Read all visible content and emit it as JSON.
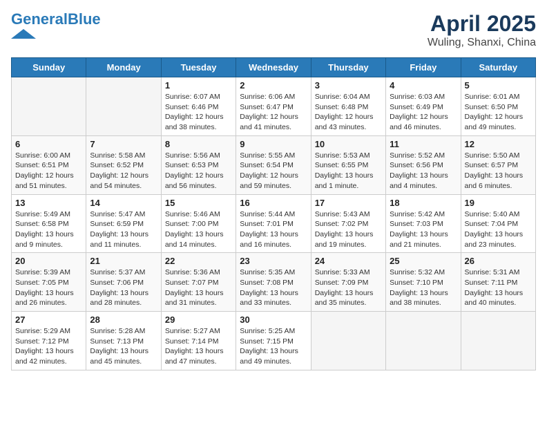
{
  "header": {
    "logo_line1": "General",
    "logo_line2": "Blue",
    "title": "April 2025",
    "subtitle": "Wuling, Shanxi, China"
  },
  "days_of_week": [
    "Sunday",
    "Monday",
    "Tuesday",
    "Wednesday",
    "Thursday",
    "Friday",
    "Saturday"
  ],
  "weeks": [
    [
      {
        "day": "",
        "empty": true
      },
      {
        "day": "",
        "empty": true
      },
      {
        "day": "1",
        "sunrise": "Sunrise: 6:07 AM",
        "sunset": "Sunset: 6:46 PM",
        "daylight": "Daylight: 12 hours and 38 minutes."
      },
      {
        "day": "2",
        "sunrise": "Sunrise: 6:06 AM",
        "sunset": "Sunset: 6:47 PM",
        "daylight": "Daylight: 12 hours and 41 minutes."
      },
      {
        "day": "3",
        "sunrise": "Sunrise: 6:04 AM",
        "sunset": "Sunset: 6:48 PM",
        "daylight": "Daylight: 12 hours and 43 minutes."
      },
      {
        "day": "4",
        "sunrise": "Sunrise: 6:03 AM",
        "sunset": "Sunset: 6:49 PM",
        "daylight": "Daylight: 12 hours and 46 minutes."
      },
      {
        "day": "5",
        "sunrise": "Sunrise: 6:01 AM",
        "sunset": "Sunset: 6:50 PM",
        "daylight": "Daylight: 12 hours and 49 minutes."
      }
    ],
    [
      {
        "day": "6",
        "sunrise": "Sunrise: 6:00 AM",
        "sunset": "Sunset: 6:51 PM",
        "daylight": "Daylight: 12 hours and 51 minutes."
      },
      {
        "day": "7",
        "sunrise": "Sunrise: 5:58 AM",
        "sunset": "Sunset: 6:52 PM",
        "daylight": "Daylight: 12 hours and 54 minutes."
      },
      {
        "day": "8",
        "sunrise": "Sunrise: 5:56 AM",
        "sunset": "Sunset: 6:53 PM",
        "daylight": "Daylight: 12 hours and 56 minutes."
      },
      {
        "day": "9",
        "sunrise": "Sunrise: 5:55 AM",
        "sunset": "Sunset: 6:54 PM",
        "daylight": "Daylight: 12 hours and 59 minutes."
      },
      {
        "day": "10",
        "sunrise": "Sunrise: 5:53 AM",
        "sunset": "Sunset: 6:55 PM",
        "daylight": "Daylight: 13 hours and 1 minute."
      },
      {
        "day": "11",
        "sunrise": "Sunrise: 5:52 AM",
        "sunset": "Sunset: 6:56 PM",
        "daylight": "Daylight: 13 hours and 4 minutes."
      },
      {
        "day": "12",
        "sunrise": "Sunrise: 5:50 AM",
        "sunset": "Sunset: 6:57 PM",
        "daylight": "Daylight: 13 hours and 6 minutes."
      }
    ],
    [
      {
        "day": "13",
        "sunrise": "Sunrise: 5:49 AM",
        "sunset": "Sunset: 6:58 PM",
        "daylight": "Daylight: 13 hours and 9 minutes."
      },
      {
        "day": "14",
        "sunrise": "Sunrise: 5:47 AM",
        "sunset": "Sunset: 6:59 PM",
        "daylight": "Daylight: 13 hours and 11 minutes."
      },
      {
        "day": "15",
        "sunrise": "Sunrise: 5:46 AM",
        "sunset": "Sunset: 7:00 PM",
        "daylight": "Daylight: 13 hours and 14 minutes."
      },
      {
        "day": "16",
        "sunrise": "Sunrise: 5:44 AM",
        "sunset": "Sunset: 7:01 PM",
        "daylight": "Daylight: 13 hours and 16 minutes."
      },
      {
        "day": "17",
        "sunrise": "Sunrise: 5:43 AM",
        "sunset": "Sunset: 7:02 PM",
        "daylight": "Daylight: 13 hours and 19 minutes."
      },
      {
        "day": "18",
        "sunrise": "Sunrise: 5:42 AM",
        "sunset": "Sunset: 7:03 PM",
        "daylight": "Daylight: 13 hours and 21 minutes."
      },
      {
        "day": "19",
        "sunrise": "Sunrise: 5:40 AM",
        "sunset": "Sunset: 7:04 PM",
        "daylight": "Daylight: 13 hours and 23 minutes."
      }
    ],
    [
      {
        "day": "20",
        "sunrise": "Sunrise: 5:39 AM",
        "sunset": "Sunset: 7:05 PM",
        "daylight": "Daylight: 13 hours and 26 minutes."
      },
      {
        "day": "21",
        "sunrise": "Sunrise: 5:37 AM",
        "sunset": "Sunset: 7:06 PM",
        "daylight": "Daylight: 13 hours and 28 minutes."
      },
      {
        "day": "22",
        "sunrise": "Sunrise: 5:36 AM",
        "sunset": "Sunset: 7:07 PM",
        "daylight": "Daylight: 13 hours and 31 minutes."
      },
      {
        "day": "23",
        "sunrise": "Sunrise: 5:35 AM",
        "sunset": "Sunset: 7:08 PM",
        "daylight": "Daylight: 13 hours and 33 minutes."
      },
      {
        "day": "24",
        "sunrise": "Sunrise: 5:33 AM",
        "sunset": "Sunset: 7:09 PM",
        "daylight": "Daylight: 13 hours and 35 minutes."
      },
      {
        "day": "25",
        "sunrise": "Sunrise: 5:32 AM",
        "sunset": "Sunset: 7:10 PM",
        "daylight": "Daylight: 13 hours and 38 minutes."
      },
      {
        "day": "26",
        "sunrise": "Sunrise: 5:31 AM",
        "sunset": "Sunset: 7:11 PM",
        "daylight": "Daylight: 13 hours and 40 minutes."
      }
    ],
    [
      {
        "day": "27",
        "sunrise": "Sunrise: 5:29 AM",
        "sunset": "Sunset: 7:12 PM",
        "daylight": "Daylight: 13 hours and 42 minutes."
      },
      {
        "day": "28",
        "sunrise": "Sunrise: 5:28 AM",
        "sunset": "Sunset: 7:13 PM",
        "daylight": "Daylight: 13 hours and 45 minutes."
      },
      {
        "day": "29",
        "sunrise": "Sunrise: 5:27 AM",
        "sunset": "Sunset: 7:14 PM",
        "daylight": "Daylight: 13 hours and 47 minutes."
      },
      {
        "day": "30",
        "sunrise": "Sunrise: 5:25 AM",
        "sunset": "Sunset: 7:15 PM",
        "daylight": "Daylight: 13 hours and 49 minutes."
      },
      {
        "day": "",
        "empty": true
      },
      {
        "day": "",
        "empty": true
      },
      {
        "day": "",
        "empty": true
      }
    ]
  ]
}
